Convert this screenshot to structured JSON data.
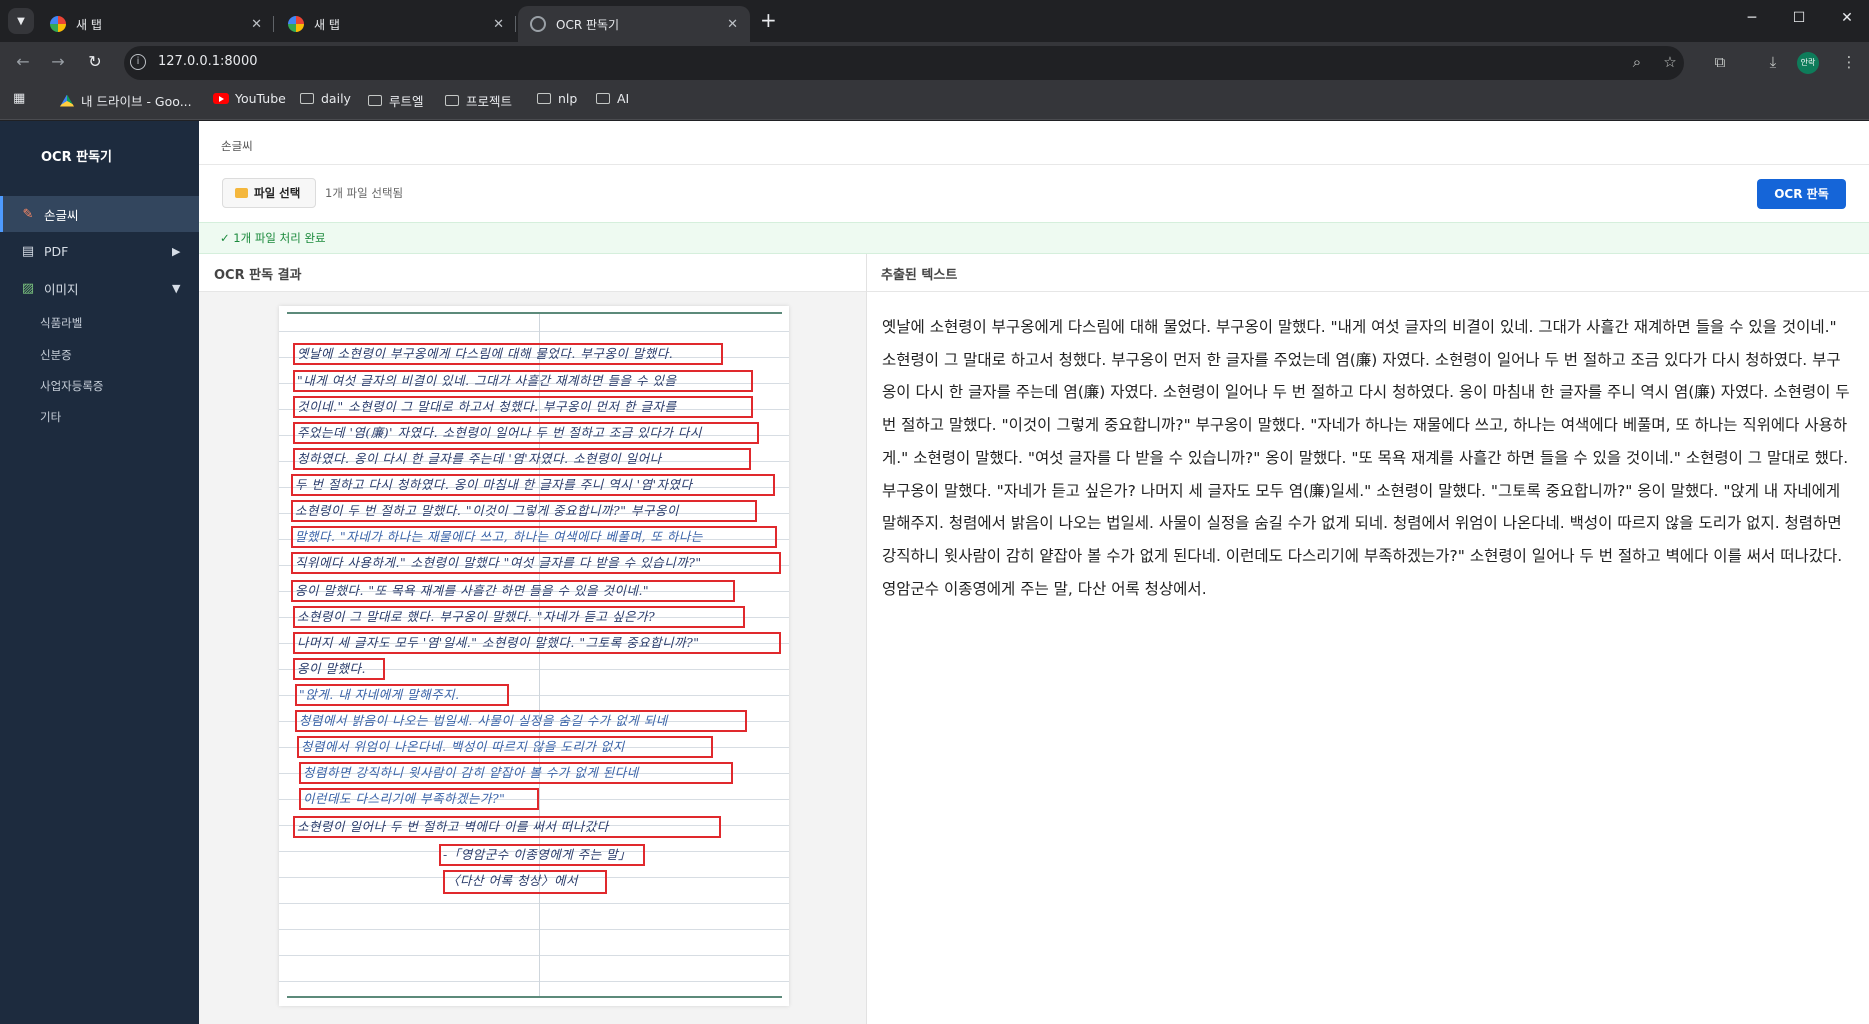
{
  "browser": {
    "tabs": [
      {
        "label": "새 탭",
        "favicon": "google-icon"
      },
      {
        "label": "새 탭",
        "favicon": "google-icon"
      },
      {
        "label": "OCR 판독기",
        "favicon": "globe-icon"
      }
    ],
    "url": "127.0.0.1:8000",
    "profile_label": "안락",
    "bookmarks": [
      {
        "label": "내 드라이브 - Goo...",
        "icon": "drive-icon"
      },
      {
        "label": "YouTube",
        "icon": "youtube-icon"
      },
      {
        "label": "daily",
        "icon": "folder-icon"
      },
      {
        "label": "루트엘",
        "icon": "folder-icon"
      },
      {
        "label": "프로젝트",
        "icon": "folder-icon"
      },
      {
        "label": "nlp",
        "icon": "folder-icon"
      },
      {
        "label": "AI",
        "icon": "folder-icon"
      }
    ]
  },
  "sidebar": {
    "title": "OCR 판독기",
    "items": [
      {
        "label": "손글씨",
        "icon": "pencil-icon",
        "active": true
      },
      {
        "label": "PDF",
        "icon": "document-icon",
        "arrow": "▶"
      },
      {
        "label": "이미지",
        "icon": "image-icon",
        "arrow": "▼"
      }
    ],
    "subitems": [
      "식품라벨",
      "신분증",
      "사업자등록증",
      "기타"
    ]
  },
  "main": {
    "breadcrumb": "손글씨",
    "file_button": "파일 선택",
    "file_status": "1개 파일 선택됨",
    "ocr_button": "OCR 판독",
    "banner": "✓ 1개 파일 처리 완료",
    "left_title": "OCR 판독 결과",
    "right_title": "추출된 텍스트",
    "extracted_text": "옛날에 소현령이 부구옹에게 다스림에 대해 물었다. 부구옹이 말했다. \"내게 여섯 글자의 비결이 있네. 그대가 사흘간 재계하면 들을 수 있을 것이네.\" 소현령이 그 말대로 하고서 청했다. 부구옹이 먼저 한 글자를 주었는데 염(廉) 자였다. 소현령이 일어나 두 번 절하고 조금 있다가 다시 청하였다. 부구옹이 다시 한 글자를 주는데 염(廉) 자였다. 소현령이 일어나 두 번 절하고 다시 청하였다. 옹이 마침내 한 글자를 주니 역시 염(廉) 자였다. 소현령이 두 번 절하고 말했다. \"이것이 그렇게 중요합니까?\" 부구옹이 말했다. \"자네가 하나는 재물에다 쓰고, 하나는 여색에다 베풀며, 또 하나는 직위에다 사용하게.\" 소현령이 말했다. \"여섯 글자를 다 받을 수 있습니까?\" 옹이 말했다. \"또 목욕 재계를 사흘간 하면 들을 수 있을 것이네.\" 소현령이 그 말대로 했다. 부구옹이 말했다. \"자네가 듣고 싶은가? 나머지 세 글자도 모두 염(廉)일세.\" 소현령이 말했다. \"그토록 중요합니까?\" 옹이 말했다. \"앉게 내 자네에게 말해주지. 청렴에서 밝음이 나오는 법일세. 사물이 실정을 숨길 수가 없게 되네. 청렴에서 위엄이 나온다네. 백성이 따르지 않을 도리가 없지. 청렴하면 강직하니 윗사람이 감히 얕잡아 볼 수가 없게 된다네. 이런데도 다스리기에 부족하겠는가?\" 소현령이 일어나 두 번 절하고 벽에다 이를 써서 떠나갔다. 영암군수 이종영에게 주는 말, 다산 어록 청상에서.",
    "handwriting_lines": [
      "옛날에 소현령이 부구옹에게 다스림에 대해 물었다. 부구옹이 말했다.",
      "\"내게 여섯 글자의 비결이 있네. 그대가 사흘간 재계하면 들을 수 있을",
      "것이네.\" 소현령이 그 말대로 하고서 청했다. 부구옹이 먼저 한 글자를",
      "주었는데 '염(廉)' 자였다. 소현령이 일어나 두 번 절하고 조금 있다가 다시",
      "청하였다. 옹이 다시 한 글자를 주는데 '염'자였다. 소현령이 일어나",
      "두 번 절하고 다시 청하였다. 옹이 마침내 한 글자를 주니 역시 '염'자였다",
      "소현령이 두 번 절하고 말했다. \"이것이 그렇게 중요합니까?\" 부구옹이",
      "말했다. \"자네가 하나는 재물에다 쓰고, 하나는 여색에다 베풀며, 또 하나는",
      "직위에다 사용하게.\" 소현령이 말했다 \"여섯 글자를 다 받을 수 있습니까?\"",
      "옹이 말했다. \"또 목욕 재계를 사흘간 하면 들을 수 있을 것이네.\"",
      "소현령이 그 말대로 했다. 부구옹이 말했다. \"자네가 듣고 싶은가?",
      "나머지 세 글자도 모두 '염'일세.\" 소현령이 말했다. \"그토록 중요합니까?\"",
      "옹이 말했다.",
      "\"앉게. 내 자네에게 말해주지.",
      "청렴에서 밝음이 나오는 법일세. 사물이 실정을 숨길 수가 없게 되네",
      "청렴에서 위엄이 나온다네. 백성이 따르지 않을 도리가 없지",
      "청렴하면 강직하니 윗사람이 감히 얕잡아 볼 수가 없게 된다네",
      "이런데도 다스리기에 부족하겠는가?\"",
      "소현령이 일어나 두 번 절하고 벽에다 이를 써서 떠나갔다",
      "-「영암군수 이종영에게 주는 말」",
      "〈다산 어록 청상〉에서"
    ]
  }
}
